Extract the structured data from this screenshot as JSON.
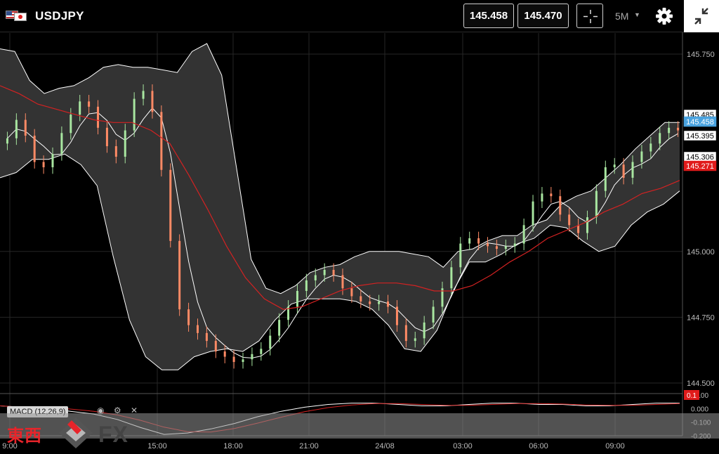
{
  "header": {
    "symbol": "USDJPY",
    "bid": "145.458",
    "ask": "145.470",
    "timeframe": "5M",
    "icons": [
      "us-flag-icon",
      "jp-flag-icon",
      "crosshair-icon",
      "chevron-down-icon",
      "gear-icon",
      "collapse-icon"
    ]
  },
  "chart_data": {
    "type": "candlestick",
    "instrument": "USDJPY",
    "timeframe": "5M",
    "price_axis": {
      "ticks": [
        "145.750",
        "145.000",
        "144.750",
        "144.500"
      ],
      "range": [
        144.46,
        145.83
      ],
      "price_labels": [
        {
          "text": "145.485",
          "color": "#ffffff"
        },
        {
          "text": "145.458",
          "color": "#4aa3df"
        },
        {
          "text": "145.395",
          "color": "#ffffff"
        },
        {
          "text": "145.306",
          "color": "#ffffff"
        },
        {
          "text": "145.271",
          "color": "#e01b1b"
        }
      ]
    },
    "time_axis": {
      "ticks": [
        "9:00",
        "15:00",
        "18:00",
        "21:00",
        "24/08",
        "03:00",
        "06:00",
        "09:00"
      ]
    },
    "series": [
      {
        "name": "close",
        "values": [
          145.43,
          145.5,
          145.44,
          145.34,
          145.32,
          145.37,
          145.45,
          145.52,
          145.57,
          145.55,
          145.47,
          145.4,
          145.36,
          145.46,
          145.58,
          145.61,
          145.53,
          145.31,
          145.04,
          144.78,
          144.72,
          144.69,
          144.66,
          144.62,
          144.6,
          144.58,
          144.59,
          144.61,
          144.63,
          144.68,
          144.74,
          144.79,
          144.85,
          144.89,
          144.91,
          144.93,
          144.91,
          144.86,
          144.83,
          144.81,
          144.8,
          144.81,
          144.79,
          144.72,
          144.66,
          144.67,
          144.73,
          144.79,
          144.86,
          144.94,
          145.03,
          145.05,
          145.03,
          145.02,
          145.01,
          145.02,
          145.03,
          145.1,
          145.19,
          145.22,
          145.21,
          145.14,
          145.1,
          145.07,
          145.13,
          145.23,
          145.32,
          145.33,
          145.28,
          145.34,
          145.38,
          145.41,
          145.45,
          145.47,
          145.46
        ]
      },
      {
        "name": "bollinger_upper",
        "values": [
          145.77,
          145.76,
          145.65,
          145.6,
          145.62,
          145.63,
          145.66,
          145.7,
          145.71,
          145.7,
          145.7,
          145.69,
          145.68,
          145.76,
          145.79,
          145.67,
          145.32,
          144.97,
          144.86,
          144.84,
          144.87,
          144.92,
          144.94,
          144.95,
          144.98,
          145.0,
          145.0,
          145.0,
          144.99,
          144.98,
          144.94,
          145.0,
          145.01,
          145.04,
          145.06,
          145.06,
          145.1,
          145.12,
          145.18,
          145.21,
          145.23,
          145.28,
          145.33,
          145.39,
          145.44,
          145.49,
          145.49
        ]
      },
      {
        "name": "bollinger_lower",
        "values": [
          145.28,
          145.3,
          145.35,
          145.35,
          145.37,
          145.33,
          145.25,
          144.98,
          144.74,
          144.6,
          144.55,
          144.55,
          144.6,
          144.62,
          144.63,
          144.62,
          144.66,
          144.74,
          144.8,
          144.82,
          144.82,
          144.82,
          144.81,
          144.78,
          144.72,
          144.63,
          144.62,
          144.7,
          144.85,
          144.96,
          144.96,
          144.99,
          145.03,
          145.05,
          145.1,
          145.09,
          145.04,
          145.0,
          145.02,
          145.1,
          145.15,
          145.18,
          145.23
        ]
      },
      {
        "name": "moving_average",
        "values": [
          145.63,
          145.6,
          145.56,
          145.54,
          145.52,
          145.5,
          145.49,
          145.49,
          145.46,
          145.41,
          145.29,
          145.16,
          145.02,
          144.9,
          144.82,
          144.78,
          144.79,
          144.82,
          144.85,
          144.87,
          144.88,
          144.88,
          144.87,
          144.85,
          144.85,
          144.87,
          144.91,
          144.96,
          145.0,
          145.05,
          145.08,
          145.11,
          145.15,
          145.18,
          145.22,
          145.24,
          145.27
        ]
      }
    ],
    "indicator": {
      "name": "MACD (12,26,9)",
      "axis_ticks": [
        "0.100",
        "0.000",
        "-0.100",
        "-0.200"
      ],
      "value_label": "0.1",
      "range": [
        -0.2,
        0.1
      ]
    },
    "colors": {
      "bullish": "#a8e6a0",
      "bearish": "#ff8a65",
      "band_line": "#ffffff",
      "moving_average": "#d32222",
      "current_price": "#4aa3df",
      "macd_line": "#ffffff",
      "signal_line": "#d32222"
    }
  },
  "macd_panel": {
    "label": "MACD (12,26,9)",
    "icons": [
      "eye-icon",
      "gear-icon",
      "close-icon"
    ]
  },
  "watermark": {
    "kanji": "東西",
    "brand": "FX"
  }
}
